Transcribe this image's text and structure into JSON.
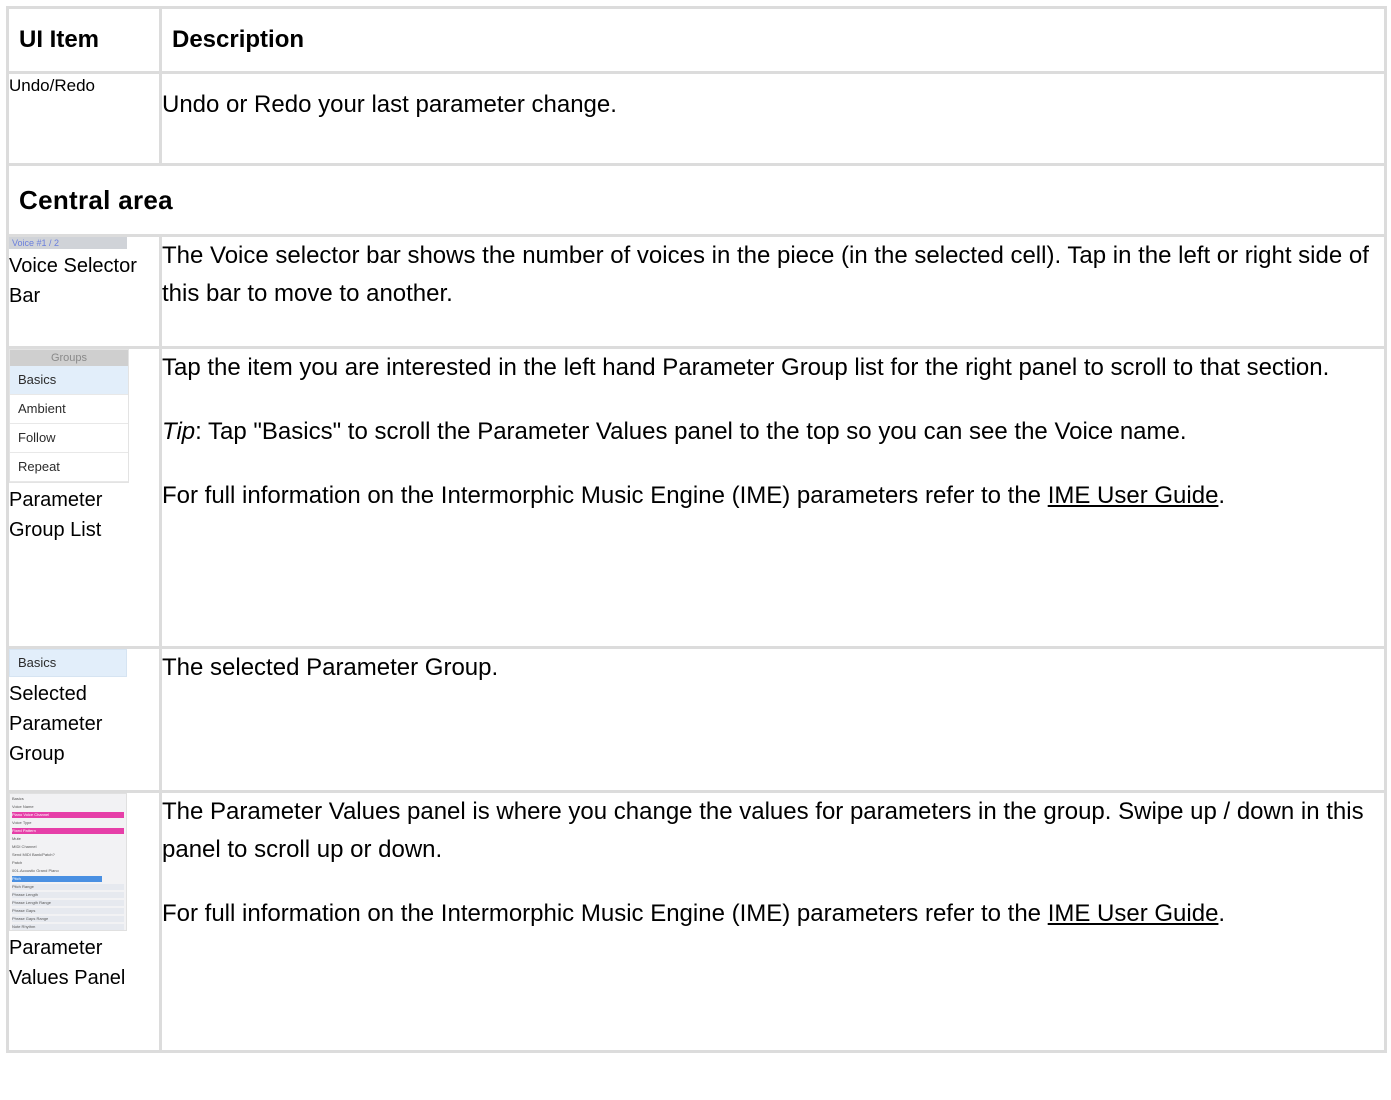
{
  "header": {
    "col1": "UI Item",
    "col2": "Description"
  },
  "rows": [
    {
      "item": "Undo/Redo",
      "desc": "Undo or Redo your last parameter change."
    }
  ],
  "section": {
    "title": "Central area"
  },
  "voice_bar": {
    "thumb_text": "Voice #1 / 2",
    "label": "Voice Selector Bar",
    "desc": "The Voice selector bar shows the number of voices in the piece (in the selected cell). Tap in the left or right side of this bar to move to another."
  },
  "group_list": {
    "thumb_header": "Groups",
    "thumb_items": [
      "Basics",
      "Ambient",
      "Follow",
      "Repeat"
    ],
    "label": "Parameter Group List",
    "desc1": "Tap the item you are interested in the left hand Parameter Group list for the right panel to scroll to that section.",
    "tip_label": "Tip",
    "tip_text": ": Tap \"Basics\" to scroll the Parameter Values panel to the top so you can see the Voice name.",
    "info_text": "For full information on the Intermorphic Music Engine (IME) parameters refer to the ",
    "link_text": "IME User Guide",
    "info_end": "."
  },
  "selected_group": {
    "thumb_text": "Basics",
    "label": "Selected Parameter Group",
    "desc": "The selected Parameter Group."
  },
  "values_panel": {
    "thumb_rows": [
      "Basics",
      "Voice Name",
      "Piano Voice Channel",
      "Voice Type",
      "Fixed Pattern",
      "Mute",
      "MIDI Channel",
      "Send MIDI Bank/Patch?",
      "Patch",
      "001-Acoustic Grand Piano",
      "Pitch",
      "Pitch Range",
      "Phrase Length",
      "Phrase Length Range",
      "Phrase Gaps",
      "Phrase Gaps Range",
      "Note Rhythm"
    ],
    "label": "Parameter Values Panel",
    "desc": "The Parameter Values panel is where you change the values for parameters in the group. Swipe up / down in this panel to scroll up or down.",
    "info_text": "For full information on the Intermorphic Music Engine (IME) parameters refer to the ",
    "link_text": "IME User Guide",
    "info_end": "."
  },
  "colors": {
    "border": "#dcdcdc",
    "thumb_pink": "#e63fa8",
    "thumb_blue": "#4a90e2",
    "selected_bg": "#e2eefa"
  }
}
